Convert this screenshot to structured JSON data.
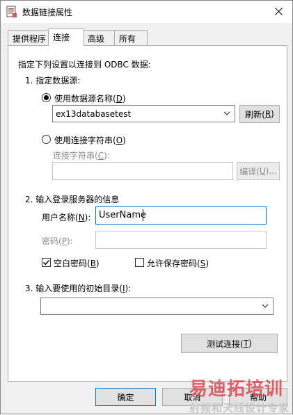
{
  "window": {
    "title": "数据链接属性"
  },
  "tabs": [
    {
      "label": "提供程序"
    },
    {
      "label": "连接"
    },
    {
      "label": "高级"
    },
    {
      "label": "所有"
    }
  ],
  "connection": {
    "intro": "指定下列设置以连接到 ODBC 数据:",
    "step1": "1. 指定数据源:",
    "use_dsn_radio": {
      "text": "使用数据源名称(",
      "key": "D",
      "end": ")"
    },
    "dsn_value": "ex13databasetest",
    "refresh_button": {
      "text": "刷新(",
      "key": "R",
      "end": ")"
    },
    "use_connstr_radio": {
      "text": "使用连接字符串(",
      "key": "O",
      "end": ")"
    },
    "connstr_label": {
      "text": "连接字符串(",
      "key": "C",
      "end": "):"
    },
    "build_button": {
      "text": "编译(",
      "key": "U",
      "end": ")..."
    },
    "step2": "2. 输入登录服务器的信息",
    "username_label": {
      "text": "用户名称(",
      "key": "N",
      "end": "):"
    },
    "username_value": "UserName",
    "password_label": {
      "text": "密码(",
      "key": "P",
      "end": "):"
    },
    "blank_password": {
      "text": "空白密码(",
      "key": "B",
      "end": ")",
      "checked": true
    },
    "allow_save_password": {
      "text": "允许保存密码(",
      "key": "S",
      "end": ")",
      "checked": false
    },
    "step3": {
      "text": "3. 输入要使用的初始目录(",
      "key": "I",
      "end": "):"
    },
    "test_button": {
      "text": "测试连接(",
      "key": "T",
      "end": ")"
    }
  },
  "footer": {
    "ok": "确定",
    "cancel": "取消",
    "help": "帮助"
  },
  "watermark": {
    "top": "易迪拓培训",
    "bottom": "射频和天线设计专家"
  }
}
